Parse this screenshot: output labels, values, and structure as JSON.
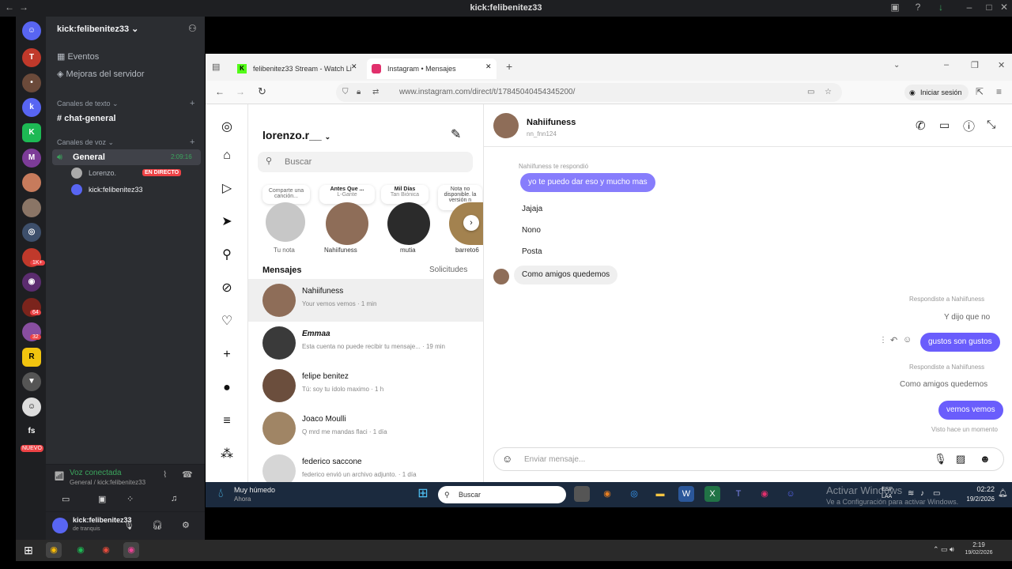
{
  "discord": {
    "window_title": "kick:felibenitez33",
    "server_name": "kick:felibenitez33",
    "events_label": "Eventos",
    "boost_label": "Mejoras del servidor",
    "text_category": "Canales de texto",
    "text_channel": "chat-general",
    "voice_category": "Canales de voz",
    "voice_channel": "General",
    "voice_timer": "2:09:16",
    "voice_members": [
      {
        "name": "Lorenzo.",
        "badge": "EN DIRECTO"
      },
      {
        "name": "kick:felibenitez33",
        "badge": ""
      }
    ],
    "voice_status": "Voz conectada",
    "voice_path": "General / kick:felibenitez33",
    "user_name": "kick:felibenitez33",
    "user_status": "de tranquis",
    "server_badges": [
      "1K+",
      "80",
      "64",
      "32"
    ],
    "server_label_fs": "fs",
    "new_badge": "NUEVO"
  },
  "browser": {
    "tabs": [
      {
        "label": "felibenitez33 Stream - Watch Li"
      },
      {
        "label": "Instagram • Mensajes"
      }
    ],
    "url": "www.instagram.com/direct/t/17845040454345200/",
    "signin_label": "Iniciar sesión"
  },
  "instagram": {
    "username": "lorenzo.r__",
    "search_placeholder": "Buscar",
    "notes": [
      {
        "text": "Comparte una canción...",
        "label": "Tu nota"
      },
      {
        "text": "Antes Que ...",
        "sub": "L-Gante",
        "label": "Nahiifuness"
      },
      {
        "text": "Mil Días",
        "sub": "Tan Biónica",
        "label": "mutia"
      },
      {
        "text": "Nota no disponible. la versión n",
        "label": "barreto6"
      }
    ],
    "messages_title": "Mensajes",
    "requests_label": "Solicitudes",
    "conversations": [
      {
        "name": "Nahiifuness",
        "preview": "Your vemos vemos · 1 min"
      },
      {
        "name": "Emmaa",
        "preview": "Esta cuenta no puede recibir tu mensaje... · 19 min"
      },
      {
        "name": "felipe benitez",
        "preview": "Tú: soy tu ídolo maximo · 1 h"
      },
      {
        "name": "Joaco Moulli",
        "preview": "Q mrd me mandas flaci · 1 día"
      },
      {
        "name": "federico saccone",
        "preview": "federico envió un archivo adjunto. · 1 día"
      }
    ],
    "chat": {
      "contact_name": "Nahiifuness",
      "contact_user": "nn_fnn124",
      "reply_label": "Nahiifuness te respondió",
      "reply_bubble": "yo te puedo dar eso y mucho mas",
      "incoming": [
        "Jajaja",
        "Nono",
        "Posta",
        "Como amigos quedemos"
      ],
      "replied_to_1": "Respondiste a Nahiifuness",
      "quoted_1": "Y dijo que no",
      "outgoing_1": "gustos son gustos",
      "replied_to_2": "Respondiste a Nahiifuness",
      "quoted_2": "Como amigos quedemos",
      "outgoing_2": "vemos vemos",
      "seen": "Visto hace un momento",
      "input_placeholder": "Enviar mensaje..."
    }
  },
  "taskbar": {
    "weather_title": "Muy húmedo",
    "weather_sub": "Ahora",
    "search_label": "Buscar",
    "watermark_1": "Activar Windows",
    "watermark_2": "Ve a Configuración para activar Windows.",
    "lang": "ESP LAA",
    "time": "02:22",
    "date": "19/2/2026",
    "host_time": "2:19",
    "host_date": "19/02/2026"
  }
}
